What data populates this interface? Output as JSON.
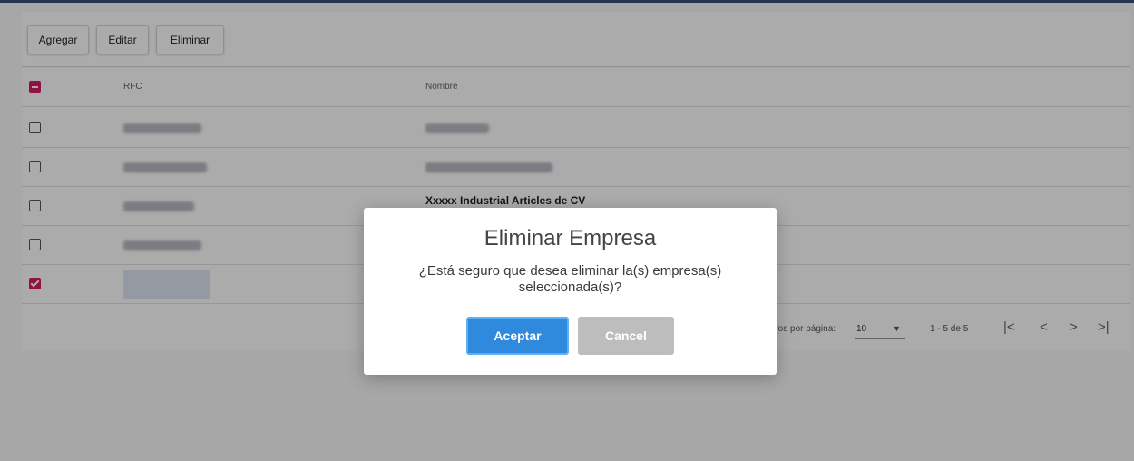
{
  "toolbar": {
    "add_label": "Agregar",
    "edit_label": "Editar",
    "delete_label": "Eliminar"
  },
  "table": {
    "columns": [
      "RFC",
      "Nombre"
    ],
    "rows": [
      {
        "checked": false,
        "rfc": "",
        "nombre": ""
      },
      {
        "checked": false,
        "rfc": "",
        "nombre": ""
      },
      {
        "checked": false,
        "rfc": "",
        "nombre": "Xxxxx Industrial Articles de CV"
      },
      {
        "checked": false,
        "rfc": "",
        "nombre": ""
      },
      {
        "checked": true,
        "rfc": "",
        "nombre": ""
      }
    ],
    "header_checkbox_state": "indeterminate"
  },
  "footer": {
    "rows_per_page_label": "atros por página:",
    "rows_per_page_value": "10",
    "range_text": "1 - 5 de 5"
  },
  "dialog": {
    "title": "Eliminar Empresa",
    "message": "¿Está seguro que desea eliminar la(s) empresa(s) seleccionada(s)?",
    "accept_label": "Aceptar",
    "cancel_label": "Cancel"
  },
  "colors": {
    "accent_pink": "#d81b60",
    "accept_blue": "#2f89dc",
    "cancel_gray": "#bdbdbd"
  },
  "icons": {
    "first_page": "first-page-icon",
    "prev_page": "chevron-left-icon",
    "next_page": "chevron-right-icon",
    "last_page": "last-page-icon",
    "dropdown": "caret-down-icon"
  }
}
